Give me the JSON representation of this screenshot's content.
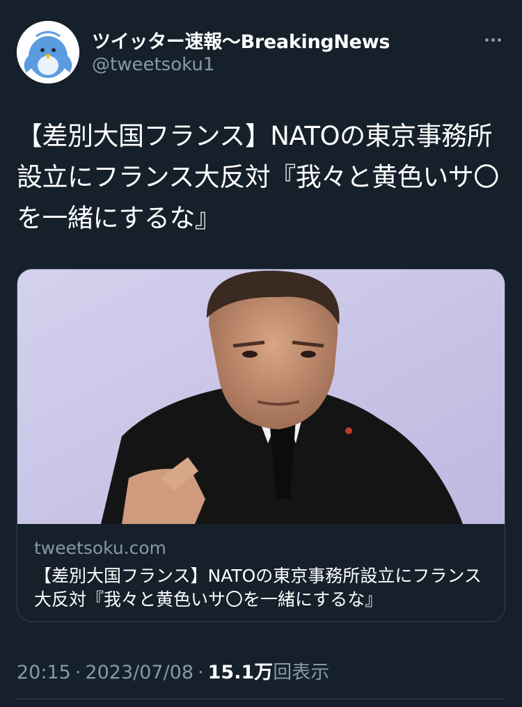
{
  "tweet": {
    "author": {
      "display_name": "ツイッター速報〜BreakingNews",
      "handle": "@tweetsoku1",
      "avatar_icon": "bird-avatar-icon"
    },
    "text": "【差別大国フランス】NATOの東京事務所設立にフランス大反対『我々と黄色いサ〇を一緒にするな』",
    "card": {
      "domain": "tweetsoku.com",
      "title": "【差別大国フランス】NATOの東京事務所設立にフランス大反対『我々と黄色いサ〇を一緒にするな』"
    },
    "meta": {
      "time": "20:15",
      "separator": "·",
      "date": "2023/07/08",
      "views_count": "15.1万",
      "views_label": "回表示"
    }
  },
  "colors": {
    "background": "#15202b",
    "secondary_text": "#8899a6",
    "border": "#38444d",
    "avatar_bird": "#5b9be0"
  }
}
